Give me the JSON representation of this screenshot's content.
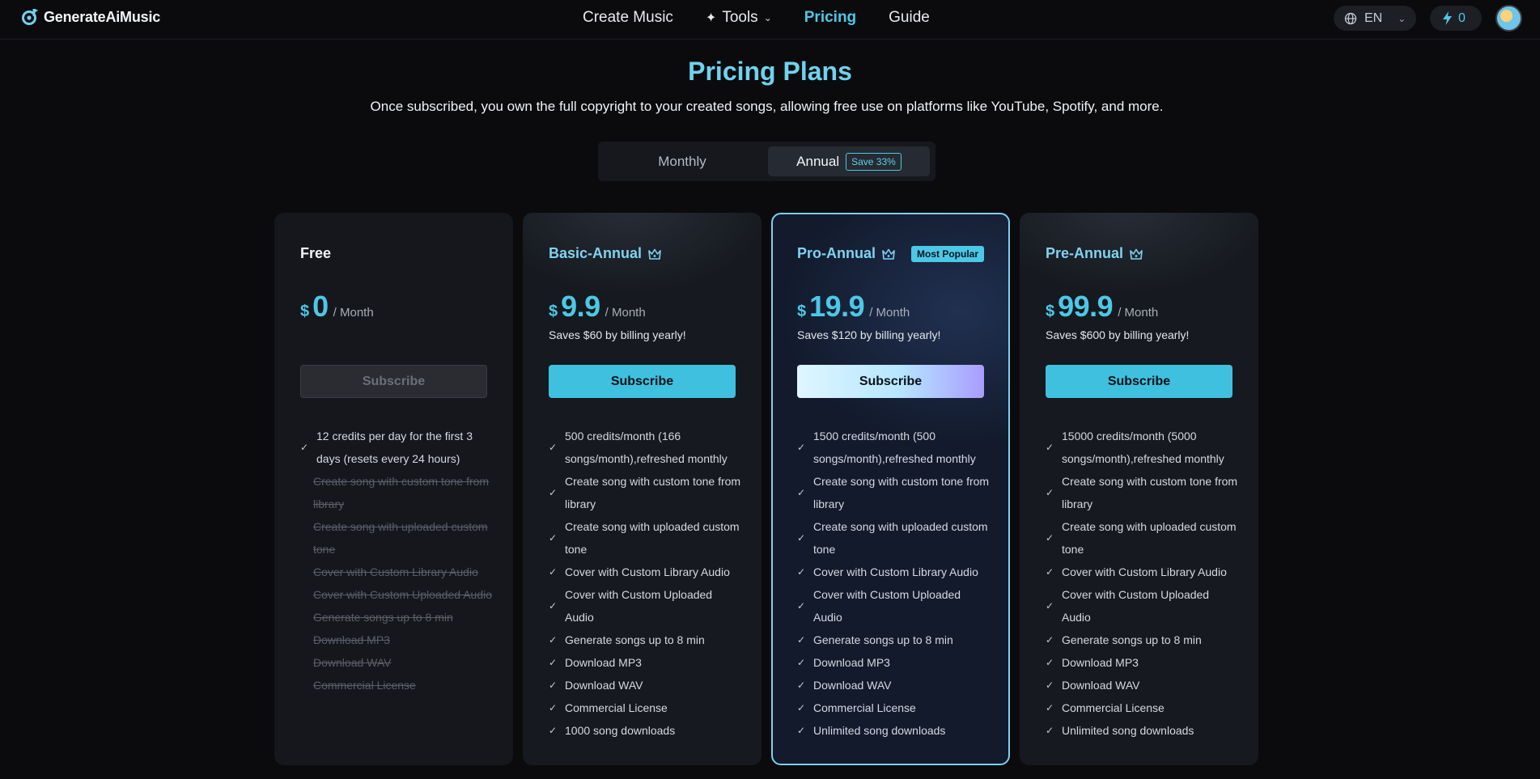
{
  "header": {
    "logo_text": "GenerateAiMusic",
    "nav": [
      {
        "label": "Create Music"
      },
      {
        "label": "Tools",
        "icon": "sparkle-icon",
        "dropdown": true
      },
      {
        "label": "Pricing",
        "active": true
      },
      {
        "label": "Guide"
      }
    ],
    "language": "EN",
    "credits": "0"
  },
  "page": {
    "title": "Pricing Plans",
    "subtitle": "Once subscribed, you own the full copyright to your created songs, allowing free use on platforms like YouTube, Spotify, and more."
  },
  "billing_toggle": {
    "monthly_label": "Monthly",
    "annual_label": "Annual",
    "save_badge": "Save 33%",
    "selected": "Annual"
  },
  "colors": {
    "accent": "#4cc8e6",
    "background": "#0b0b0d",
    "card": "#16191f",
    "pro_border": "#7fcff0"
  },
  "plans": [
    {
      "name": "Free",
      "currency": "$",
      "price": "0",
      "period": "/ Month",
      "saves": "",
      "button": "Subscribe",
      "button_enabled": false,
      "features": [
        {
          "text": "12 credits per day for the first 3 days (resets every 24 hours)",
          "included": true
        },
        {
          "text": "Create song with custom tone from library",
          "included": false
        },
        {
          "text": "Create song with uploaded custom tone",
          "included": false
        },
        {
          "text": "Cover with Custom Library Audio",
          "included": false
        },
        {
          "text": "Cover with Custom Uploaded Audio",
          "included": false
        },
        {
          "text": "Generate songs up to 8 min",
          "included": false
        },
        {
          "text": "Download MP3",
          "included": false
        },
        {
          "text": "Download WAV",
          "included": false
        },
        {
          "text": "Commercial License",
          "included": false
        }
      ]
    },
    {
      "name": "Basic-Annual",
      "currency": "$",
      "price": "9.9",
      "period": "/ Month",
      "saves": "Saves $60 by billing yearly!",
      "button": "Subscribe",
      "button_enabled": true,
      "features": [
        {
          "text": "500 credits/month (166 songs/month),refreshed monthly",
          "included": true
        },
        {
          "text": "Create song with custom tone from library",
          "included": true
        },
        {
          "text": "Create song with uploaded custom tone",
          "included": true
        },
        {
          "text": "Cover with Custom Library Audio",
          "included": true
        },
        {
          "text": "Cover with Custom Uploaded Audio",
          "included": true
        },
        {
          "text": "Generate songs up to 8 min",
          "included": true
        },
        {
          "text": "Download MP3",
          "included": true
        },
        {
          "text": "Download WAV",
          "included": true
        },
        {
          "text": "Commercial License",
          "included": true
        },
        {
          "text": "1000 song downloads",
          "included": true
        }
      ]
    },
    {
      "name": "Pro-Annual",
      "badge": "Most Popular",
      "currency": "$",
      "price": "19.9",
      "period": "/ Month",
      "saves": "Saves $120 by billing yearly!",
      "button": "Subscribe",
      "button_enabled": true,
      "features": [
        {
          "text": "1500 credits/month (500 songs/month),refreshed monthly",
          "included": true
        },
        {
          "text": "Create song with custom tone from library",
          "included": true
        },
        {
          "text": "Create song with uploaded custom tone",
          "included": true
        },
        {
          "text": "Cover with Custom Library Audio",
          "included": true
        },
        {
          "text": "Cover with Custom Uploaded Audio",
          "included": true
        },
        {
          "text": "Generate songs up to 8 min",
          "included": true
        },
        {
          "text": "Download MP3",
          "included": true
        },
        {
          "text": "Download WAV",
          "included": true
        },
        {
          "text": "Commercial License",
          "included": true
        },
        {
          "text": "Unlimited song downloads",
          "included": true
        }
      ]
    },
    {
      "name": "Pre-Annual",
      "currency": "$",
      "price": "99.9",
      "period": "/ Month",
      "saves": "Saves $600 by billing yearly!",
      "button": "Subscribe",
      "button_enabled": true,
      "features": [
        {
          "text": "15000 credits/month (5000 songs/month),refreshed monthly",
          "included": true
        },
        {
          "text": "Create song with custom tone from library",
          "included": true
        },
        {
          "text": "Create song with uploaded custom tone",
          "included": true
        },
        {
          "text": "Cover with Custom Library Audio",
          "included": true
        },
        {
          "text": "Cover with Custom Uploaded Audio",
          "included": true
        },
        {
          "text": "Generate songs up to 8 min",
          "included": true
        },
        {
          "text": "Download MP3",
          "included": true
        },
        {
          "text": "Download WAV",
          "included": true
        },
        {
          "text": "Commercial License",
          "included": true
        },
        {
          "text": "Unlimited song downloads",
          "included": true
        }
      ]
    }
  ]
}
